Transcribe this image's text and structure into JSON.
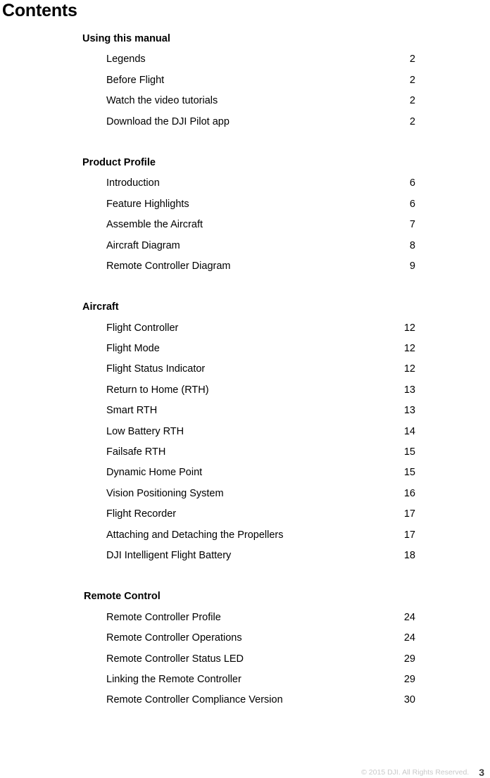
{
  "page": {
    "title": "Contents"
  },
  "toc": {
    "sections": [
      {
        "heading": "Using this manual",
        "entries": [
          {
            "label": "Legends",
            "page": "2"
          },
          {
            "label": "Before Flight",
            "page": "2"
          },
          {
            "label": "Watch the video tutorials",
            "page": "2"
          },
          {
            "label": "Download the DJI Pilot app",
            "page": "2"
          }
        ]
      },
      {
        "heading": "Product Profile",
        "entries": [
          {
            "label": "Introduction",
            "page": "6"
          },
          {
            "label": "Feature Highlights",
            "page": "6"
          },
          {
            "label": "Assemble the Aircraft",
            "page": "7"
          },
          {
            "label": "Aircraft Diagram",
            "page": "8"
          },
          {
            "label": "Remote Controller Diagram",
            "page": "9"
          }
        ]
      },
      {
        "heading": "Aircraft",
        "entries": [
          {
            "label": "Flight Controller",
            "page": "12"
          },
          {
            "label": "Flight Mode",
            "page": "12"
          },
          {
            "label": "Flight Status Indicator",
            "page": "12"
          },
          {
            "label": "Return to Home (RTH)",
            "page": "13"
          },
          {
            "label": "Smart RTH",
            "page": "13"
          },
          {
            "label": "Low Battery RTH",
            "page": "14"
          },
          {
            "label": "Failsafe RTH",
            "page": "15"
          },
          {
            "label": "Dynamic Home Point",
            "page": "15"
          },
          {
            "label": "Vision Positioning System",
            "page": "16"
          },
          {
            "label": "Flight Recorder",
            "page": "17"
          },
          {
            "label": "Attaching and Detaching the Propellers",
            "page": "17"
          },
          {
            "label": "DJI Intelligent Flight Battery",
            "page": "18"
          }
        ]
      },
      {
        "heading": "Remote Control",
        "entries": [
          {
            "label": "Remote Controller Profile",
            "page": "24"
          },
          {
            "label": "Remote Controller Operations",
            "page": "24"
          },
          {
            "label": "Remote Controller Status LED",
            "page": "29"
          },
          {
            "label": "Linking the Remote Controller",
            "page": "29"
          },
          {
            "label": "Remote Controller Compliance Version",
            "page": "30"
          }
        ]
      }
    ]
  },
  "footer": {
    "copyright": "© 2015 DJI. All Rights Reserved.",
    "page_number": "3"
  }
}
